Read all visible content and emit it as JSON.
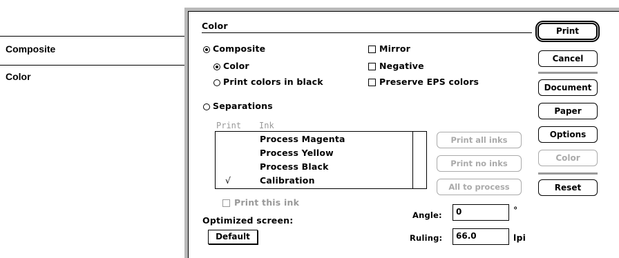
{
  "callouts": {
    "composite": "Composite",
    "color": "Color"
  },
  "dialog": {
    "section_title": "Color",
    "composite_label": "Composite",
    "color_label": "Color",
    "print_colors_black_label": "Print colors in black",
    "mirror_label": "Mirror",
    "negative_label": "Negative",
    "preserve_eps_label": "Preserve EPS colors",
    "separations_label": "Separations",
    "ink_header_print": "Print",
    "ink_header_ink": "Ink",
    "inks": [
      {
        "check": "",
        "name": "Process Magenta"
      },
      {
        "check": "",
        "name": "Process Yellow"
      },
      {
        "check": "",
        "name": "Process Black"
      },
      {
        "check": "√",
        "name": "Calibration"
      }
    ],
    "print_all_inks": "Print all inks",
    "print_no_inks": "Print no inks",
    "all_to_process": "All to process",
    "print_this_ink_label": "Print this ink",
    "optimized_screen_label": "Optimized screen:",
    "screen_popup_value": "Default",
    "angle_label": "Angle:",
    "angle_value": "0",
    "angle_unit": "°",
    "ruling_label": "Ruling:",
    "ruling_value": "66.0",
    "ruling_unit": "lpi"
  },
  "buttons": {
    "print": "Print",
    "cancel": "Cancel",
    "document": "Document",
    "paper": "Paper",
    "options": "Options",
    "color": "Color",
    "reset": "Reset"
  },
  "state": {
    "composite_selected": true,
    "color_selected": true,
    "print_colors_black_selected": false,
    "separations_selected": false,
    "mirror_checked": false,
    "negative_checked": false,
    "preserve_eps_checked": false,
    "print_this_ink_checked": false
  }
}
